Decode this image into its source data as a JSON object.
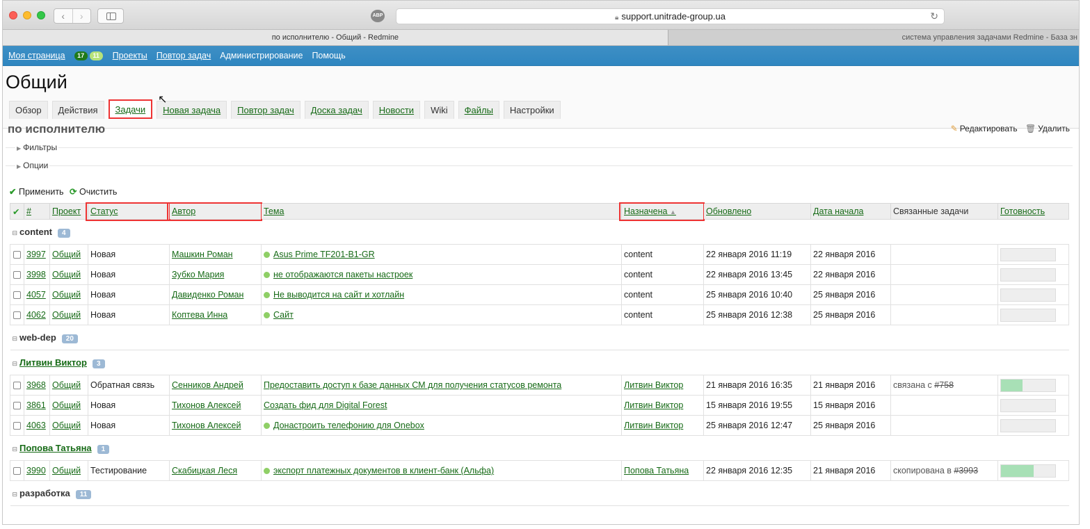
{
  "browser": {
    "url": "support.unitrade-group.ua",
    "tab_active": "по исполнителю - Общий - Redmine",
    "tab_inactive": "система управления задачами Redmine - База зн",
    "abp": "ABP"
  },
  "topmenu": {
    "my_page": "Моя страница",
    "count1": "17",
    "count2": "11",
    "projects": "Проекты",
    "repeat": "Повтор задач",
    "admin": "Администрирование",
    "help": "Помощь"
  },
  "project": {
    "title": "Общий",
    "tabs": [
      "Обзор",
      "Действия",
      "Задачи",
      "Новая задача",
      "Повтор задач",
      "Доска задач",
      "Новости",
      "Wiki",
      "Файлы",
      "Настройки"
    ]
  },
  "query": {
    "title": "по исполнителю",
    "edit": "Редактировать",
    "delete": "Удалить",
    "filters": "Фильтры",
    "options": "Опции",
    "apply": "Применить",
    "clear": "Очистить"
  },
  "columns": [
    "✔",
    "#",
    "Проект",
    "Статус",
    "Автор",
    "Тема",
    "Назначена",
    "Обновлено",
    "Дата начала",
    "Связанные задачи",
    "Готовность"
  ],
  "groups": [
    {
      "name": "content",
      "count": "4"
    },
    {
      "name": "web-dep",
      "count": "20"
    },
    {
      "name": "Литвин Виктор",
      "count": "3"
    },
    {
      "name": "Попова Татьяна",
      "count": "1"
    },
    {
      "name": "разработка",
      "count": "11"
    }
  ],
  "rows": [
    {
      "id": "3997",
      "project": "Общий",
      "status": "Новая",
      "author": "Машкин Роман",
      "subject": "Asus Prime TF201-B1-GR",
      "assigned": "content",
      "updated": "22 января 2016 11:19",
      "start": "22 января 2016",
      "related": "",
      "progress": 0
    },
    {
      "id": "3998",
      "project": "Общий",
      "status": "Новая",
      "author": "Зубко Мария",
      "subject": "не отображаются пакеты настроек",
      "assigned": "content",
      "updated": "22 января 2016 13:45",
      "start": "22 января 2016",
      "related": "",
      "progress": 0
    },
    {
      "id": "4057",
      "project": "Общий",
      "status": "Новая",
      "author": "Давиденко Роман",
      "subject": "Не выводится на сайт и хотлайн",
      "assigned": "content",
      "updated": "25 января 2016 10:40",
      "start": "25 января 2016",
      "related": "",
      "progress": 0
    },
    {
      "id": "4062",
      "project": "Общий",
      "status": "Новая",
      "author": "Коптева Инна",
      "subject": "Сайт",
      "assigned": "content",
      "updated": "25 января 2016 12:38",
      "start": "25 января 2016",
      "related": "",
      "progress": 0
    },
    {
      "id": "3968",
      "project": "Общий",
      "status": "Обратная связь",
      "author": "Сенников Андрей",
      "subject": "Предоставить доступ к базе данных СМ для получения статусов ремонта",
      "assigned": "Литвин Виктор",
      "updated": "21 января 2016 16:35",
      "start": "21 января 2016",
      "related": "связана с",
      "related_link": "#758",
      "progress": 40
    },
    {
      "id": "3861",
      "project": "Общий",
      "status": "Новая",
      "author": "Тихонов Алексей",
      "subject": "Создать фид для Digital Forest",
      "assigned": "Литвин Виктор",
      "updated": "15 января 2016 19:55",
      "start": "15 января 2016",
      "related": "",
      "progress": 0
    },
    {
      "id": "4063",
      "project": "Общий",
      "status": "Новая",
      "author": "Тихонов Алексей",
      "subject": "Донастроить телефонию для Onebox",
      "assigned": "Литвин Виктор",
      "updated": "25 января 2016 12:47",
      "start": "25 января 2016",
      "related": "",
      "progress": 0
    },
    {
      "id": "3990",
      "project": "Общий",
      "status": "Тестирование",
      "author": "Скабицкая Леся",
      "subject": "экспорт платежных документов в клиент-банк (Альфа)",
      "assigned": "Попова Татьяна",
      "updated": "22 января 2016 12:35",
      "start": "21 января 2016",
      "related": "скопирована в",
      "related_link": "#3993",
      "progress": 60
    }
  ]
}
